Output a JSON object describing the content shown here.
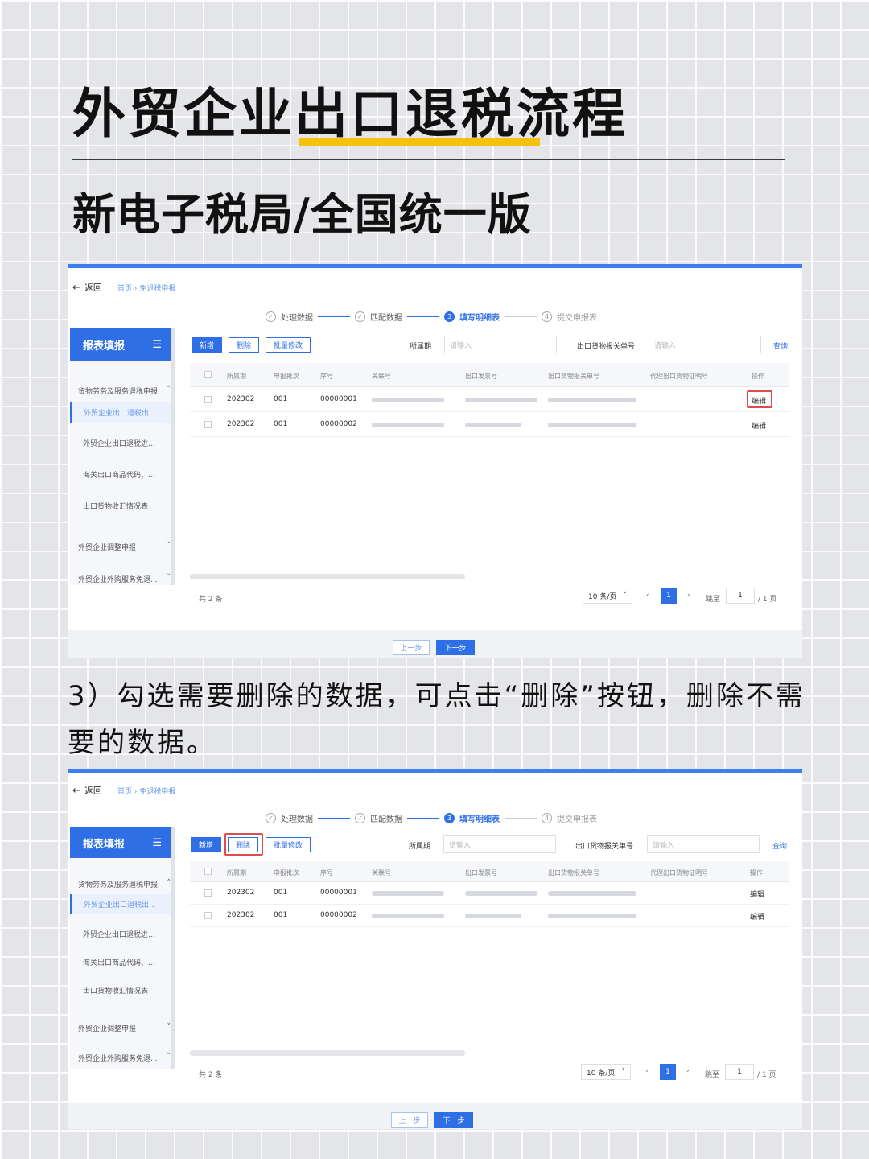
{
  "header": {
    "title": "外贸企业出口退税流程",
    "subtitle": "新电子税局/全国统一版"
  },
  "caption": "3）勾选需要删除的数据，可点击“删除”按钮，删除不需要的数据。",
  "app": {
    "back_label": "返回",
    "breadcrumb": "首页 › 免退税申报",
    "steps": [
      {
        "label": "处理数据",
        "state": "done",
        "icon": "check-circle-icon"
      },
      {
        "label": "匹配数据",
        "state": "done",
        "icon": "check-circle-icon"
      },
      {
        "label": "填写明细表",
        "state": "active",
        "number": "3"
      },
      {
        "label": "提交申报表",
        "state": "todo",
        "number": "4"
      }
    ],
    "sidebar": {
      "title": "报表填报",
      "menu_icon": "menu-icon",
      "group": "货物劳务及服务退税申报",
      "items": [
        "外贸企业出口退税出...",
        "外贸企业出口退税进...",
        "海关出口商品代码、...",
        "出口货物收汇情况表"
      ],
      "collapsed_groups": [
        "外贸企业调整申报",
        "外贸企业外购服务免退..."
      ]
    },
    "toolbar": {
      "add": "新增",
      "delete": "删除",
      "batch_edit": "批量修改",
      "period_label": "所属期",
      "period_placeholder": "请输入",
      "customs_label": "出口货物报关单号",
      "customs_placeholder": "请输入",
      "query": "查询"
    },
    "table": {
      "columns": [
        "所属期",
        "申报批次",
        "序号",
        "关联号",
        "出口发票号",
        "出口货物报关单号",
        "代理出口货物证明号",
        "操作"
      ],
      "rows": [
        {
          "period": "202302",
          "batch": "001",
          "seq": "00000001",
          "action": "编辑"
        },
        {
          "period": "202302",
          "batch": "001",
          "seq": "00000002",
          "action": "编辑"
        }
      ]
    },
    "pagination": {
      "total": "共 2 条",
      "page_size": "10 条/页",
      "current_page": "1",
      "goto_label": "跳至",
      "goto_value": "1",
      "page_total": "/ 1 页"
    },
    "footer": {
      "prev": "上一步",
      "next": "下一步"
    }
  }
}
